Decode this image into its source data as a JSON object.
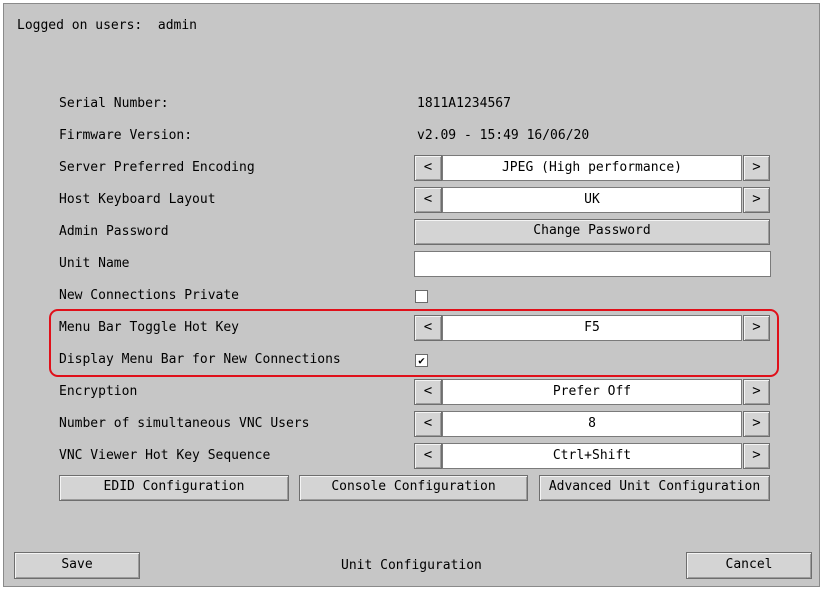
{
  "header": {
    "logged_on": "Logged on users:  admin"
  },
  "rows": {
    "serial": {
      "label": "Serial Number:",
      "value": "1811A1234567"
    },
    "firmware": {
      "label": "Firmware Version:",
      "value": "v2.09 - 15:49 16/06/20"
    },
    "encoding": {
      "label": "Server Preferred Encoding",
      "value": "JPEG (High performance)"
    },
    "keyboard": {
      "label": "Host Keyboard Layout",
      "value": "UK"
    },
    "admin_password": {
      "label": "Admin Password",
      "button": "Change Password"
    },
    "unit_name": {
      "label": "Unit Name",
      "value": ""
    },
    "private": {
      "label": "New Connections Private",
      "checked": false
    },
    "hotkey": {
      "label": "Menu Bar Toggle Hot Key",
      "value": "F5"
    },
    "display_menu": {
      "label": "Display Menu Bar for New Connections",
      "checked": true
    },
    "encryption": {
      "label": "Encryption",
      "value": "Prefer Off"
    },
    "vnc_users": {
      "label": "Number of simultaneous VNC Users",
      "value": "8"
    },
    "vnc_hotkey": {
      "label": "VNC Viewer Hot Key Sequence",
      "value": "Ctrl+Shift"
    }
  },
  "arrows": {
    "left": "<",
    "right": ">"
  },
  "check_mark": "✔",
  "config_buttons": {
    "edid": "EDID Configuration",
    "console": "Console Configuration",
    "advanced": "Advanced Unit Configuration"
  },
  "footer": {
    "save": "Save",
    "title": "Unit Configuration",
    "cancel": "Cancel"
  },
  "colors": {
    "background": "#c6c6c6",
    "highlight": "#e0101a"
  }
}
